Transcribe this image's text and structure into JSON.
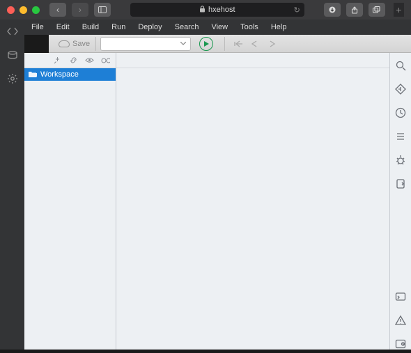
{
  "colors": {
    "accent": "#1e7fd6",
    "red": "#ff5f57",
    "yellow": "#febc2e",
    "green": "#28c840"
  },
  "browser": {
    "url_host": "hxehost"
  },
  "menus": [
    "File",
    "Edit",
    "Build",
    "Run",
    "Deploy",
    "Search",
    "View",
    "Tools",
    "Help"
  ],
  "toolbar": {
    "save_label": "Save"
  },
  "file_panel": {
    "workspace_label": "Workspace"
  }
}
